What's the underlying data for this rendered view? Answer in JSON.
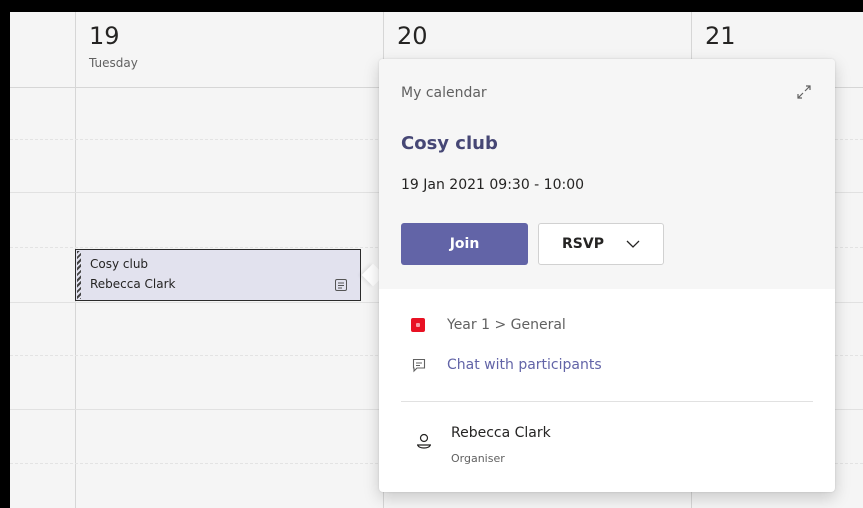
{
  "days": [
    {
      "number": "19",
      "name": "Tuesday"
    },
    {
      "number": "20",
      "name": ""
    },
    {
      "number": "21",
      "name": ""
    }
  ],
  "event": {
    "title": "Cosy club",
    "organiser": "Rebecca Clark"
  },
  "popup": {
    "calendar_name": "My calendar",
    "title": "Cosy club",
    "datetime": "19 Jan 2021 09:30 - 10:00",
    "join_label": "Join",
    "rsvp_label": "RSVP",
    "channel": "Year 1 > General",
    "chat_label": "Chat with participants",
    "organiser_name": "Rebecca Clark",
    "organiser_role": "Organiser"
  },
  "colors": {
    "accent": "#6264a7",
    "title": "#464775",
    "team_badge": "#e81123",
    "event_bg": "#e2e2ee"
  },
  "icons": [
    "expand-icon",
    "chevron-down-icon",
    "team-icon",
    "chat-icon",
    "person-icon",
    "meeting-details-icon"
  ]
}
